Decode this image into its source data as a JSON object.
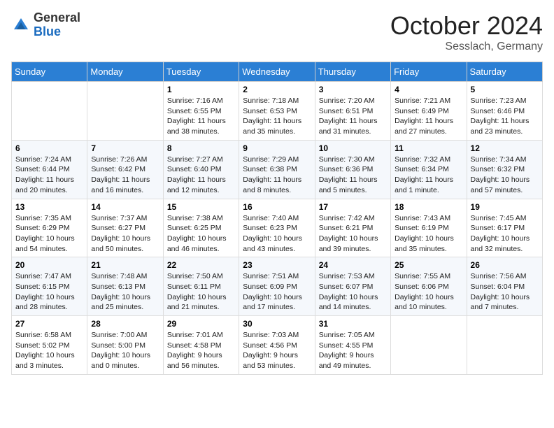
{
  "header": {
    "logo_general": "General",
    "logo_blue": "Blue",
    "month_title": "October 2024",
    "location": "Sesslach, Germany"
  },
  "days_of_week": [
    "Sunday",
    "Monday",
    "Tuesday",
    "Wednesday",
    "Thursday",
    "Friday",
    "Saturday"
  ],
  "weeks": [
    [
      {
        "num": "",
        "detail": ""
      },
      {
        "num": "",
        "detail": ""
      },
      {
        "num": "1",
        "detail": "Sunrise: 7:16 AM\nSunset: 6:55 PM\nDaylight: 11 hours and 38 minutes."
      },
      {
        "num": "2",
        "detail": "Sunrise: 7:18 AM\nSunset: 6:53 PM\nDaylight: 11 hours and 35 minutes."
      },
      {
        "num": "3",
        "detail": "Sunrise: 7:20 AM\nSunset: 6:51 PM\nDaylight: 11 hours and 31 minutes."
      },
      {
        "num": "4",
        "detail": "Sunrise: 7:21 AM\nSunset: 6:49 PM\nDaylight: 11 hours and 27 minutes."
      },
      {
        "num": "5",
        "detail": "Sunrise: 7:23 AM\nSunset: 6:46 PM\nDaylight: 11 hours and 23 minutes."
      }
    ],
    [
      {
        "num": "6",
        "detail": "Sunrise: 7:24 AM\nSunset: 6:44 PM\nDaylight: 11 hours and 20 minutes."
      },
      {
        "num": "7",
        "detail": "Sunrise: 7:26 AM\nSunset: 6:42 PM\nDaylight: 11 hours and 16 minutes."
      },
      {
        "num": "8",
        "detail": "Sunrise: 7:27 AM\nSunset: 6:40 PM\nDaylight: 11 hours and 12 minutes."
      },
      {
        "num": "9",
        "detail": "Sunrise: 7:29 AM\nSunset: 6:38 PM\nDaylight: 11 hours and 8 minutes."
      },
      {
        "num": "10",
        "detail": "Sunrise: 7:30 AM\nSunset: 6:36 PM\nDaylight: 11 hours and 5 minutes."
      },
      {
        "num": "11",
        "detail": "Sunrise: 7:32 AM\nSunset: 6:34 PM\nDaylight: 11 hours and 1 minute."
      },
      {
        "num": "12",
        "detail": "Sunrise: 7:34 AM\nSunset: 6:32 PM\nDaylight: 10 hours and 57 minutes."
      }
    ],
    [
      {
        "num": "13",
        "detail": "Sunrise: 7:35 AM\nSunset: 6:29 PM\nDaylight: 10 hours and 54 minutes."
      },
      {
        "num": "14",
        "detail": "Sunrise: 7:37 AM\nSunset: 6:27 PM\nDaylight: 10 hours and 50 minutes."
      },
      {
        "num": "15",
        "detail": "Sunrise: 7:38 AM\nSunset: 6:25 PM\nDaylight: 10 hours and 46 minutes."
      },
      {
        "num": "16",
        "detail": "Sunrise: 7:40 AM\nSunset: 6:23 PM\nDaylight: 10 hours and 43 minutes."
      },
      {
        "num": "17",
        "detail": "Sunrise: 7:42 AM\nSunset: 6:21 PM\nDaylight: 10 hours and 39 minutes."
      },
      {
        "num": "18",
        "detail": "Sunrise: 7:43 AM\nSunset: 6:19 PM\nDaylight: 10 hours and 35 minutes."
      },
      {
        "num": "19",
        "detail": "Sunrise: 7:45 AM\nSunset: 6:17 PM\nDaylight: 10 hours and 32 minutes."
      }
    ],
    [
      {
        "num": "20",
        "detail": "Sunrise: 7:47 AM\nSunset: 6:15 PM\nDaylight: 10 hours and 28 minutes."
      },
      {
        "num": "21",
        "detail": "Sunrise: 7:48 AM\nSunset: 6:13 PM\nDaylight: 10 hours and 25 minutes."
      },
      {
        "num": "22",
        "detail": "Sunrise: 7:50 AM\nSunset: 6:11 PM\nDaylight: 10 hours and 21 minutes."
      },
      {
        "num": "23",
        "detail": "Sunrise: 7:51 AM\nSunset: 6:09 PM\nDaylight: 10 hours and 17 minutes."
      },
      {
        "num": "24",
        "detail": "Sunrise: 7:53 AM\nSunset: 6:07 PM\nDaylight: 10 hours and 14 minutes."
      },
      {
        "num": "25",
        "detail": "Sunrise: 7:55 AM\nSunset: 6:06 PM\nDaylight: 10 hours and 10 minutes."
      },
      {
        "num": "26",
        "detail": "Sunrise: 7:56 AM\nSunset: 6:04 PM\nDaylight: 10 hours and 7 minutes."
      }
    ],
    [
      {
        "num": "27",
        "detail": "Sunrise: 6:58 AM\nSunset: 5:02 PM\nDaylight: 10 hours and 3 minutes."
      },
      {
        "num": "28",
        "detail": "Sunrise: 7:00 AM\nSunset: 5:00 PM\nDaylight: 10 hours and 0 minutes."
      },
      {
        "num": "29",
        "detail": "Sunrise: 7:01 AM\nSunset: 4:58 PM\nDaylight: 9 hours and 56 minutes."
      },
      {
        "num": "30",
        "detail": "Sunrise: 7:03 AM\nSunset: 4:56 PM\nDaylight: 9 hours and 53 minutes."
      },
      {
        "num": "31",
        "detail": "Sunrise: 7:05 AM\nSunset: 4:55 PM\nDaylight: 9 hours and 49 minutes."
      },
      {
        "num": "",
        "detail": ""
      },
      {
        "num": "",
        "detail": ""
      }
    ]
  ]
}
